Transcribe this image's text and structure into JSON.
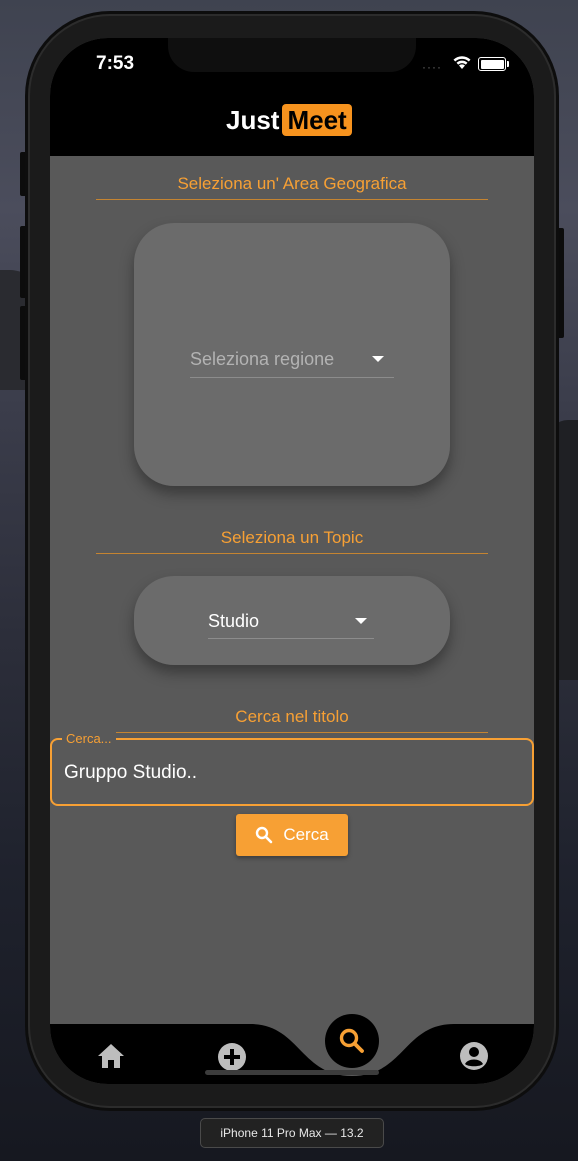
{
  "status_bar": {
    "time": "7:53"
  },
  "app_bar": {
    "logo_part1": "Just",
    "logo_part2": "Meet"
  },
  "area_section": {
    "title": "Seleziona un' Area Geografica",
    "region_dropdown": {
      "placeholder": "Seleziona regione"
    }
  },
  "topic_section": {
    "title": "Seleziona un Topic",
    "topic_dropdown": {
      "value": "Studio"
    }
  },
  "title_search": {
    "heading": "Cerca nel titolo",
    "field_label": "Cerca...",
    "field_value": "Gruppo Studio..",
    "button_label": "Cerca"
  },
  "bottom_nav": {
    "items": [
      {
        "icon": "home-icon"
      },
      {
        "icon": "add-circle-icon"
      },
      {
        "icon": "search-icon",
        "active": true
      },
      {
        "icon": "account-circle-icon"
      }
    ]
  },
  "simulator": {
    "device_label": "iPhone 11 Pro Max — 13.2"
  },
  "colors": {
    "accent": "#f7a034",
    "background": "#595959",
    "card": "#6b6b6b",
    "bar": "#000000"
  }
}
